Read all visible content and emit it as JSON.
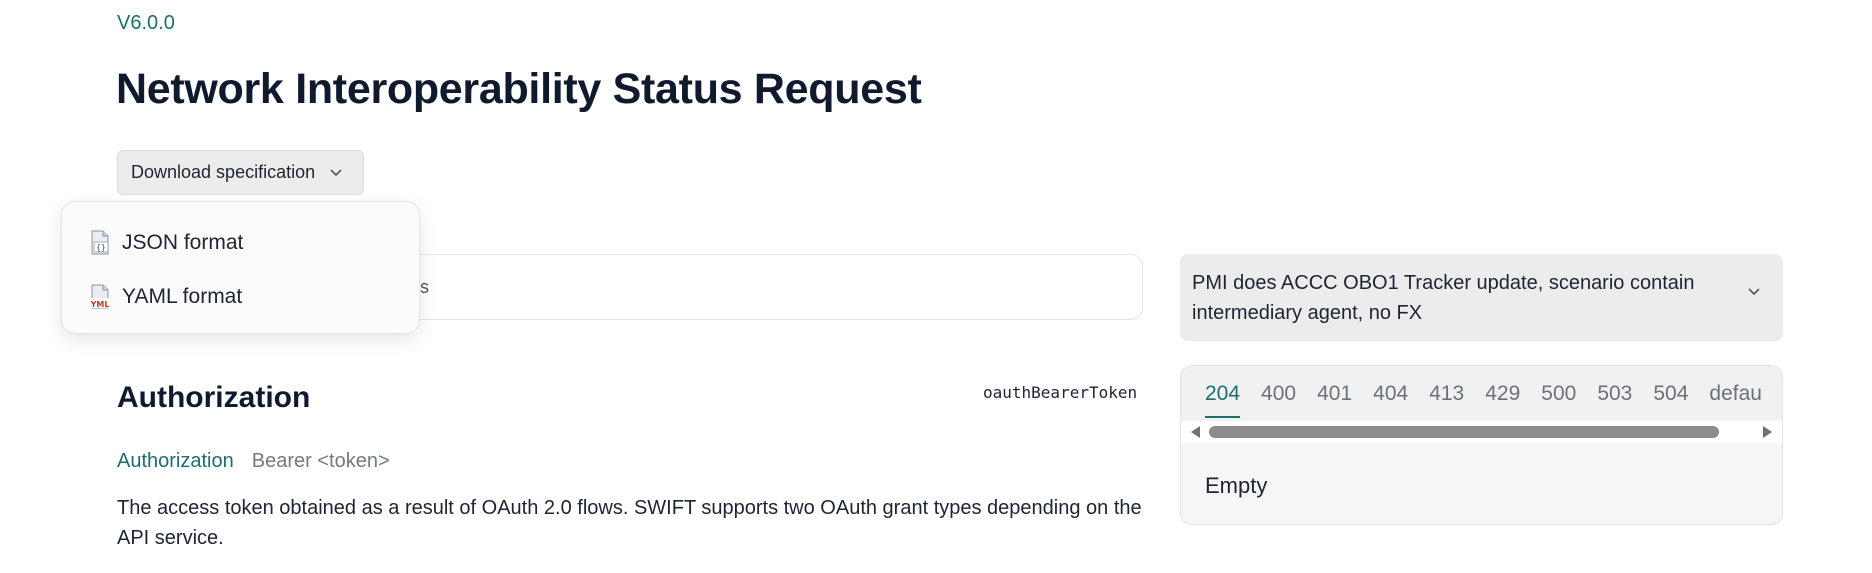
{
  "header": {
    "version": "V6.0.0",
    "title": "Network Interoperability Status Request"
  },
  "download": {
    "label": "Download specification",
    "menu": [
      {
        "label": "JSON format",
        "icon": "json-file-icon"
      },
      {
        "label": "YAML format",
        "icon": "yaml-file-icon"
      }
    ]
  },
  "server": {
    "visible_text": "s"
  },
  "example": {
    "selected": "PMI does ACCC OBO1 Tracker update, scenario contain intermediary agent, no FX"
  },
  "authorization": {
    "heading": "Authorization",
    "scheme": "oauthBearerToken",
    "param_name": "Authorization",
    "param_type": "Bearer <token>",
    "description": "The access token obtained as a result of OAuth 2.0 flows. SWIFT supports two OAuth grant types depending on the API service."
  },
  "responses": {
    "tabs": [
      "204",
      "400",
      "401",
      "404",
      "413",
      "429",
      "500",
      "503",
      "504",
      "defau"
    ],
    "active_tab": "204",
    "body": "Empty"
  },
  "colors": {
    "accent": "#1e6e6e",
    "title": "#0f1a2e",
    "button_bg": "#ececec"
  }
}
